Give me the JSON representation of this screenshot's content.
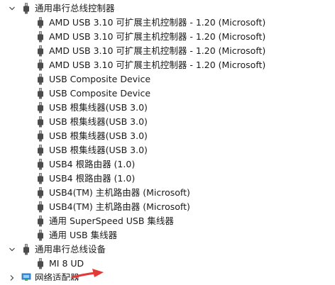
{
  "tree": {
    "categories": [
      {
        "label": "通用串行总线控制器",
        "expanded": true,
        "chevron_icon": "chevron-down-icon",
        "icon": "usb-plug-icon",
        "items": [
          {
            "label": "AMD USB 3.10 可扩展主机控制器 - 1.20 (Microsoft)",
            "icon": "usb-plug-icon"
          },
          {
            "label": "AMD USB 3.10 可扩展主机控制器 - 1.20 (Microsoft)",
            "icon": "usb-plug-icon"
          },
          {
            "label": "AMD USB 3.10 可扩展主机控制器 - 1.20 (Microsoft)",
            "icon": "usb-plug-icon"
          },
          {
            "label": "AMD USB 3.10 可扩展主机控制器 - 1.20 (Microsoft)",
            "icon": "usb-plug-icon"
          },
          {
            "label": "USB Composite Device",
            "icon": "usb-plug-icon"
          },
          {
            "label": "USB Composite Device",
            "icon": "usb-plug-icon"
          },
          {
            "label": "USB 根集线器(USB 3.0)",
            "icon": "usb-plug-icon"
          },
          {
            "label": "USB 根集线器(USB 3.0)",
            "icon": "usb-plug-icon"
          },
          {
            "label": "USB 根集线器(USB 3.0)",
            "icon": "usb-plug-icon"
          },
          {
            "label": "USB 根集线器(USB 3.0)",
            "icon": "usb-plug-icon"
          },
          {
            "label": "USB4 根路由器 (1.0)",
            "icon": "usb-plug-icon"
          },
          {
            "label": "USB4 根路由器 (1.0)",
            "icon": "usb-plug-icon"
          },
          {
            "label": "USB4(TM) 主机路由器 (Microsoft)",
            "icon": "usb-plug-icon"
          },
          {
            "label": "USB4(TM) 主机路由器 (Microsoft)",
            "icon": "usb-plug-icon"
          },
          {
            "label": "通用 SuperSpeed USB 集线器",
            "icon": "usb-plug-icon"
          },
          {
            "label": "通用 USB 集线器",
            "icon": "usb-plug-icon"
          }
        ]
      },
      {
        "label": "通用串行总线设备",
        "expanded": true,
        "chevron_icon": "chevron-down-icon",
        "icon": "usb-plug-icon",
        "items": [
          {
            "label": "MI 8 UD",
            "icon": "usb-plug-icon"
          }
        ]
      },
      {
        "label": "网络适配器",
        "expanded": false,
        "chevron_icon": "chevron-right-icon",
        "icon": "network-adapter-icon",
        "items": []
      }
    ]
  },
  "annotation": {
    "icon": "red-arrow-icon",
    "color": "#e53935"
  }
}
